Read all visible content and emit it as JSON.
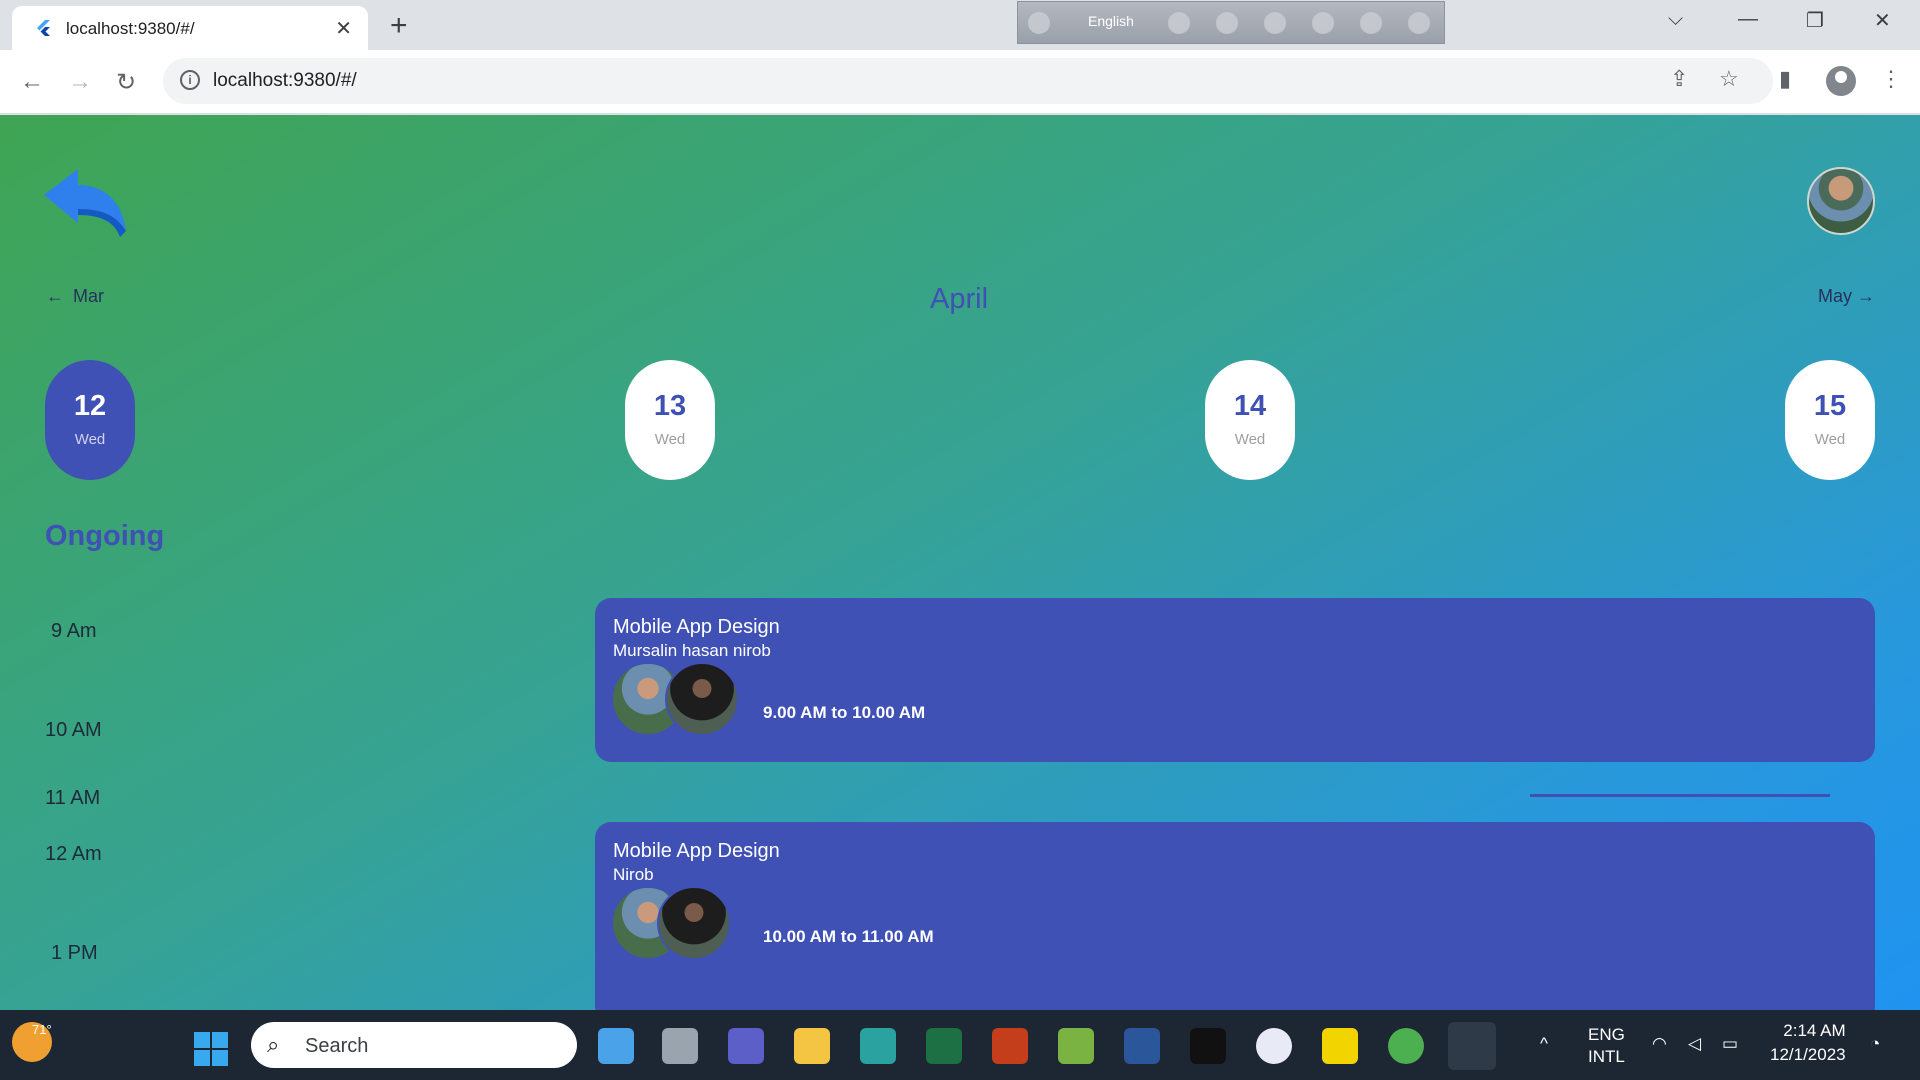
{
  "browser": {
    "tab_title": "localhost:9380/#/",
    "url": "localhost:9380/#/",
    "ime_language": "English"
  },
  "app": {
    "month_prev": "Mar",
    "month_current": "April",
    "month_next": "May",
    "days": [
      {
        "num": "12",
        "weekday": "Wed",
        "selected": true
      },
      {
        "num": "13",
        "weekday": "Wed",
        "selected": false
      },
      {
        "num": "14",
        "weekday": "Wed",
        "selected": false
      },
      {
        "num": "15",
        "weekday": "Wed",
        "selected": false
      }
    ],
    "section_title": "Ongoing",
    "times": [
      "9 Am",
      "10 AM",
      "11 AM",
      "12 Am",
      "1 PM"
    ],
    "events": [
      {
        "title": "Mobile App Design",
        "subtitle": "Mursalin hasan nirob",
        "time": "9.00 AM to 10.00 AM"
      },
      {
        "title": "Mobile App Design",
        "subtitle": "Nirob",
        "time": "10.00 AM to 11.00 AM"
      }
    ],
    "accent_color": "#3f51b5"
  },
  "taskbar": {
    "weather_temp": "71°",
    "search_label": "Search",
    "lang_line1": "ENG",
    "lang_line2": "INTL",
    "time": "2:14 AM",
    "date": "12/1/2023"
  }
}
